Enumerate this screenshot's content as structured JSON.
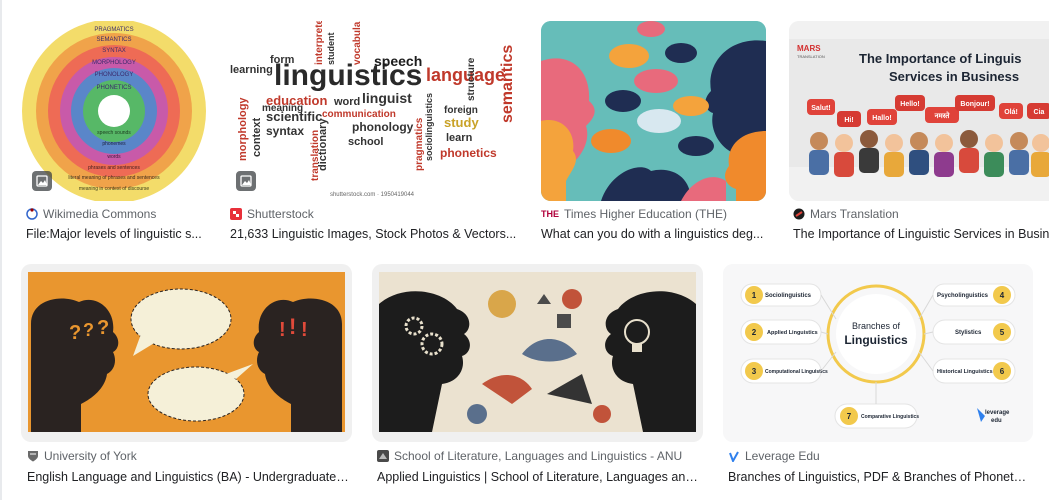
{
  "results": [
    {
      "source": "Wikimedia Commons",
      "title": "File:Major levels of linguistic s..."
    },
    {
      "source": "Shutterstock",
      "title": "21,633 Linguistic Images, Stock Photos & Vectors..."
    },
    {
      "source": "Times Higher Education (THE)",
      "title": "What can you do with a linguistics deg..."
    },
    {
      "source": "Mars Translation",
      "title": "The Importance of Linguistic Services in Busine"
    },
    {
      "source": "University of York",
      "title": "English Language and Linguistics (BA) - Undergraduate, ..."
    },
    {
      "source": "School of Literature, Languages and Linguistics - ANU",
      "title": "Applied Linguistics | School of Literature, Languages and..."
    },
    {
      "source": "Leverage Edu",
      "title": "Branches of Linguistics, PDF & Branches of Phonetic..."
    }
  ],
  "thumb1": {
    "rings": [
      "PRAGMATICS",
      "SEMANTICS",
      "SYNTAX",
      "MORPHOLOGY",
      "PHONOLOGY",
      "PHONETICS"
    ],
    "inner": [
      "speech sounds",
      "phonemes",
      "words",
      "phrases and sentences",
      "literal meaning of phrases and sentences",
      "meaning in context of discourse"
    ]
  },
  "thumb2": {
    "main": "linguistics",
    "language": "language",
    "speech": "speech",
    "semantics": "semantics",
    "words": [
      "learning",
      "form",
      "education",
      "word",
      "linguist",
      "phonology",
      "syntax",
      "scientific",
      "dictionary",
      "school",
      "phonetics",
      "foreign",
      "study",
      "learn",
      "meaning",
      "communication",
      "context",
      "morphology",
      "structure",
      "translation",
      "vocabulary",
      "interpreter",
      "student",
      "pragmatics",
      "sociolinguistics"
    ],
    "watermark": "shutterstock.com · 1950419044"
  },
  "thumb4": {
    "brand": "MARS",
    "brand_sub": "TRANSLATION",
    "headline1": "The Importance of Linguis",
    "headline2": "Services in Business",
    "bubbles": [
      "Salut!",
      "Hi!",
      "Hallo!",
      "Hello!",
      "नमस्ते",
      "Bonjour!",
      "Olá!",
      "Cia"
    ]
  },
  "thumb7": {
    "center1": "Branches of",
    "center2": "Linguistics",
    "items": [
      {
        "n": "1",
        "label": "Sociolinguistics"
      },
      {
        "n": "2",
        "label": "Applied Linguistics"
      },
      {
        "n": "3",
        "label": "Computational Linguistics"
      },
      {
        "n": "4",
        "label": "Psycholinguistics"
      },
      {
        "n": "5",
        "label": "Stylistics"
      },
      {
        "n": "6",
        "label": "Historical Linguistics"
      },
      {
        "n": "7",
        "label": "Comparative Linguistics"
      }
    ],
    "logo1": "leverage",
    "logo2": "edu"
  },
  "colors": {
    "source": "#5f6368",
    "title": "#202124",
    "accent": "#fbbc04"
  }
}
